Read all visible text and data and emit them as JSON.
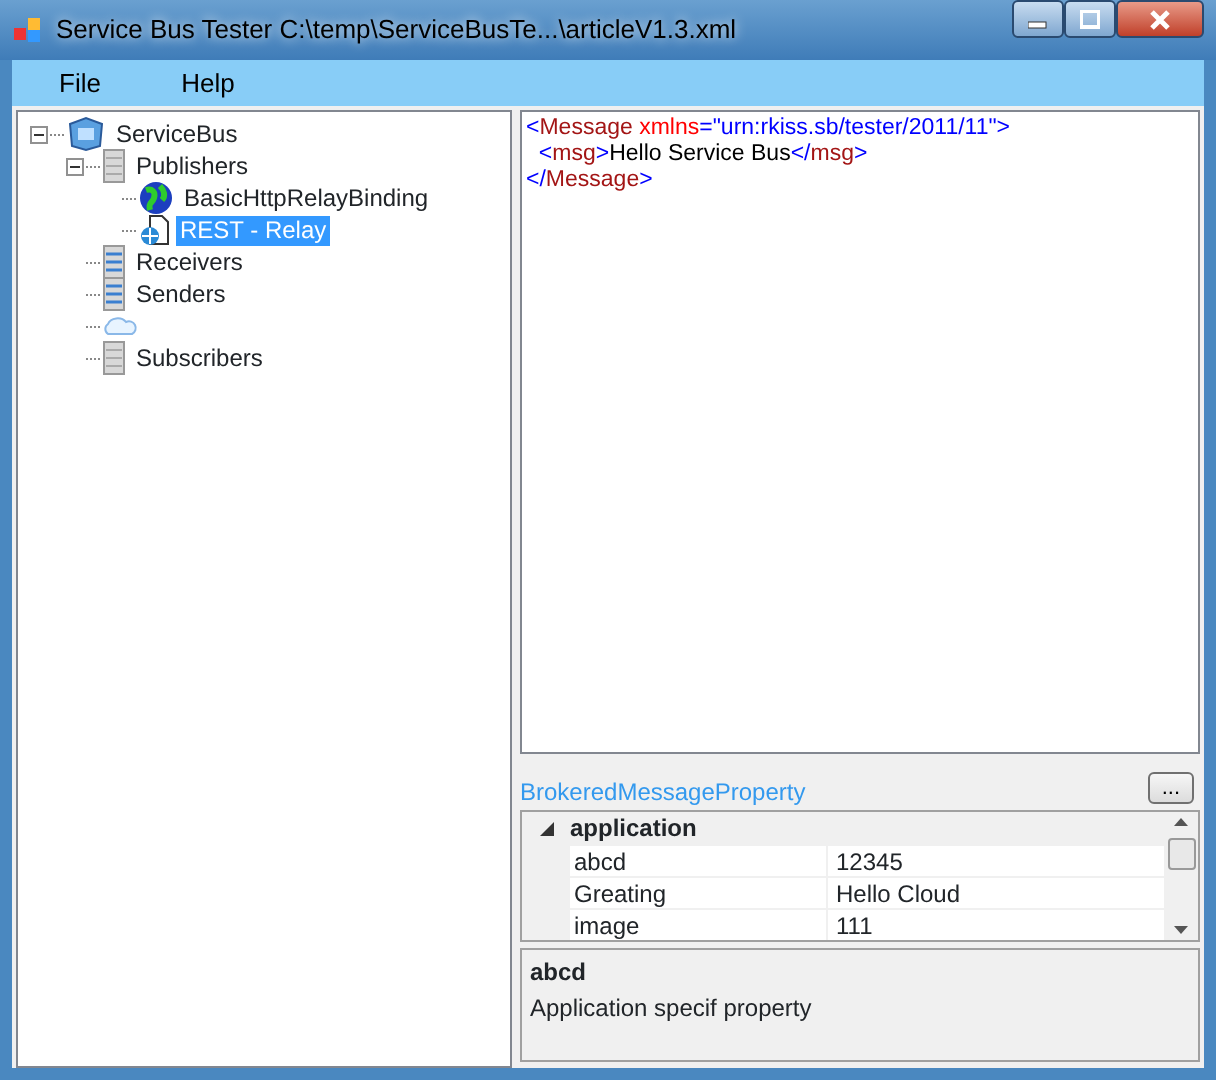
{
  "window": {
    "title": "Service Bus Tester C:\\temp\\ServiceBusTe...\\articleV1.3.xml"
  },
  "menu": [
    {
      "label": "File"
    },
    {
      "label": "Help"
    }
  ],
  "tree": [
    {
      "label": "ServiceBus",
      "kind": "root",
      "expanded": true,
      "selected": false,
      "children": [
        {
          "label": "Publishers",
          "kind": "server",
          "expanded": true,
          "selected": false,
          "children": [
            {
              "label": "BasicHttpRelayBinding",
              "kind": "globe",
              "selected": false
            },
            {
              "label": "REST - Relay",
              "kind": "document",
              "selected": true
            }
          ]
        },
        {
          "label": "Receivers",
          "kind": "server-blue",
          "selected": false
        },
        {
          "label": "Senders",
          "kind": "server-blue",
          "selected": false
        },
        {
          "kind": "cloud",
          "selected": false
        },
        {
          "label": "Subscribers",
          "kind": "server",
          "selected": false
        }
      ]
    }
  ],
  "editor": {
    "lines": [
      [
        {
          "kind": "punct",
          "text": "<"
        },
        {
          "kind": "name",
          "text": "Message"
        },
        {
          "kind": "attr",
          "text": " xmlns"
        },
        {
          "kind": "punct",
          "text": "=\"urn:rkiss.sb/tester/2011/11\">"
        }
      ],
      [
        {
          "kind": "punct",
          "text": "  <"
        },
        {
          "kind": "name",
          "text": "msg"
        },
        {
          "kind": "punct",
          "text": ">"
        },
        {
          "kind": "text",
          "text": "Hello Service Bus"
        },
        {
          "kind": "punct",
          "text": "</"
        },
        {
          "kind": "name",
          "text": "msg"
        },
        {
          "kind": "punct",
          "text": ">"
        }
      ],
      [
        {
          "kind": "punct",
          "text": "</"
        },
        {
          "kind": "name",
          "text": "Message"
        },
        {
          "kind": "punct",
          "text": ">"
        }
      ]
    ]
  },
  "properties": {
    "label": "BrokeredMessageProperty",
    "button": "...",
    "category": {
      "label": "application",
      "expanded": true
    },
    "rows": [
      {
        "name": "abcd",
        "value": "12345"
      },
      {
        "name": "Greating",
        "value": "Hello Cloud"
      },
      {
        "name": "image",
        "value": "111"
      }
    ],
    "description": {
      "title": "abcd",
      "text": "Application specif property"
    }
  }
}
